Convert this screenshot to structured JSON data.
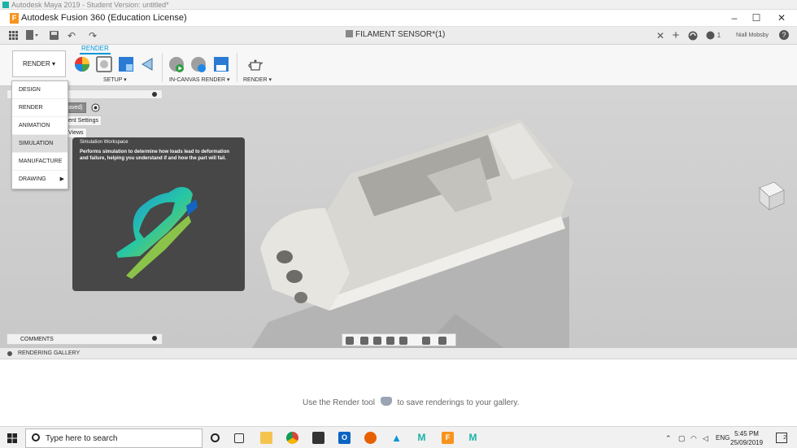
{
  "maya_window": {
    "title": "Autodesk Maya 2019 - Student Version: untitled*"
  },
  "window": {
    "title": "Autodesk Fusion 360 (Education License)",
    "minimize": "–",
    "maximize": "☐",
    "close": "✕"
  },
  "toolbar": {
    "document_title": "FILAMENT SENSOR*(1)",
    "close_tab": "✕",
    "new_tab": "+",
    "notifications": "1",
    "user_name": "Niall Mobsby",
    "help": "?"
  },
  "ribbon": {
    "workspace_label": "RENDER ▾",
    "active_tab": "RENDER",
    "groups": {
      "setup": "SETUP ▾",
      "in_canvas": "IN-CANVAS RENDER ▾",
      "render": "RENDER ▾"
    }
  },
  "browser": {
    "item_saved": "aved)",
    "item_env": "ent Settings",
    "item_views": "Views"
  },
  "workspace_menu": {
    "items": [
      {
        "label": "DESIGN"
      },
      {
        "label": "RENDER"
      },
      {
        "label": "ANIMATION"
      },
      {
        "label": "SIMULATION"
      },
      {
        "label": "MANUFACTURE"
      },
      {
        "label": "DRAWING",
        "submenu_arrow": "▶"
      }
    ],
    "highlighted": "SIMULATION"
  },
  "tooltip": {
    "title": "Simulation Workspace",
    "body": "Performs simulation to determine how loads lead to deformation and failure, helping you understand if and how the part will fail."
  },
  "comments": {
    "label": "COMMENTS"
  },
  "gallery": {
    "header": "RENDERING GALLERY",
    "message_before": "Use the Render tool",
    "message_after": "to save renderings to your gallery."
  },
  "taskbar": {
    "search_placeholder": "Type here to search",
    "language": "ENG",
    "time": "5:45 PM",
    "date": "25/09/2019",
    "notification_count": "2"
  },
  "colors": {
    "accent": "#0696d7",
    "fusion_orange": "#f7941d",
    "tooltip_bg": "#474747",
    "canvas_bg": "#cecece"
  }
}
